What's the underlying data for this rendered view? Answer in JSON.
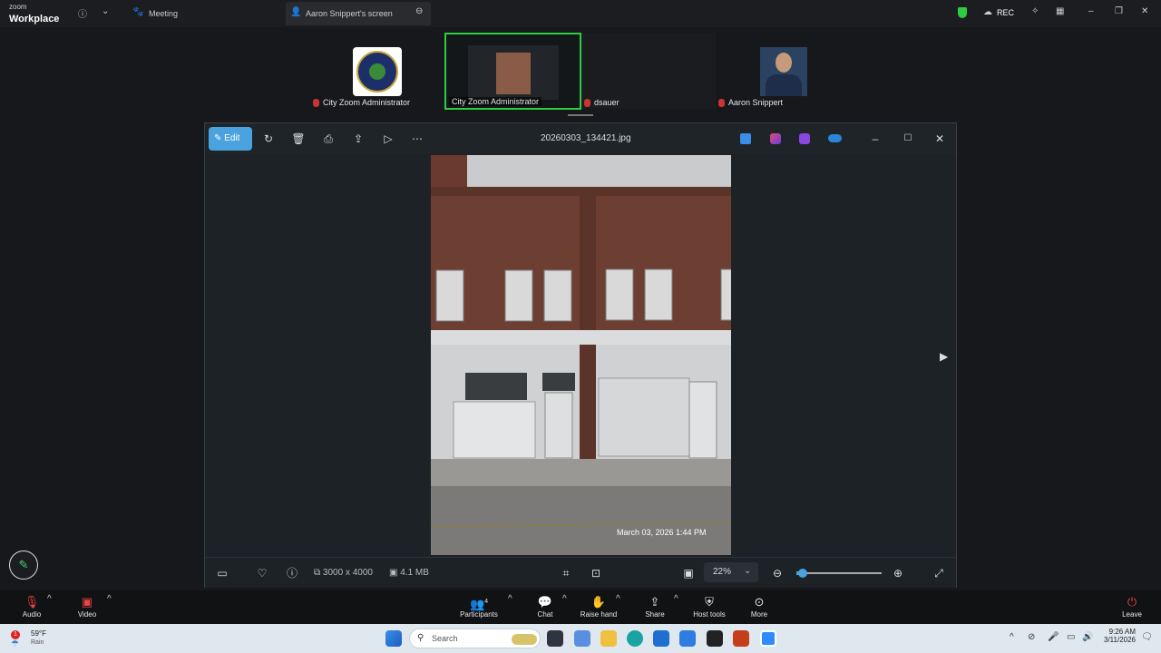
{
  "zoom": {
    "logo_small": "zoom",
    "logo_big": "Workplace",
    "meeting_tab": "Meeting",
    "screen_tab": "Aaron Snippert's screen",
    "rec_label": "REC"
  },
  "participants": [
    {
      "name": "City Zoom Administrator"
    },
    {
      "name": "City Zoom Administrator"
    },
    {
      "name": "dsauer"
    },
    {
      "name": "Aaron Snippert"
    }
  ],
  "photos_app": {
    "edit_label": "Edit",
    "filename": "20260303_134421.jpg",
    "dimensions": "3000 x 4000",
    "filesize": "4.1 MB",
    "zoom_level": "22%",
    "photo_timestamp": "March 03, 2026 1:44 PM"
  },
  "controls": {
    "audio": "Audio",
    "video": "Video",
    "participants": "Participants",
    "participant_count": "4",
    "chat": "Chat",
    "raise_hand": "Raise hand",
    "share": "Share",
    "host_tools": "Host tools",
    "more": "More",
    "leave": "Leave"
  },
  "taskbar": {
    "weather_temp": "59°F",
    "weather_desc": "Rain",
    "weather_badge": "1",
    "search_label": "Search",
    "time": "9:26 AM",
    "date": "3/11/2026"
  },
  "colors": {
    "accent": "#4aa3df",
    "active_speaker": "#2ecc40",
    "mute_red": "#cc3333"
  }
}
